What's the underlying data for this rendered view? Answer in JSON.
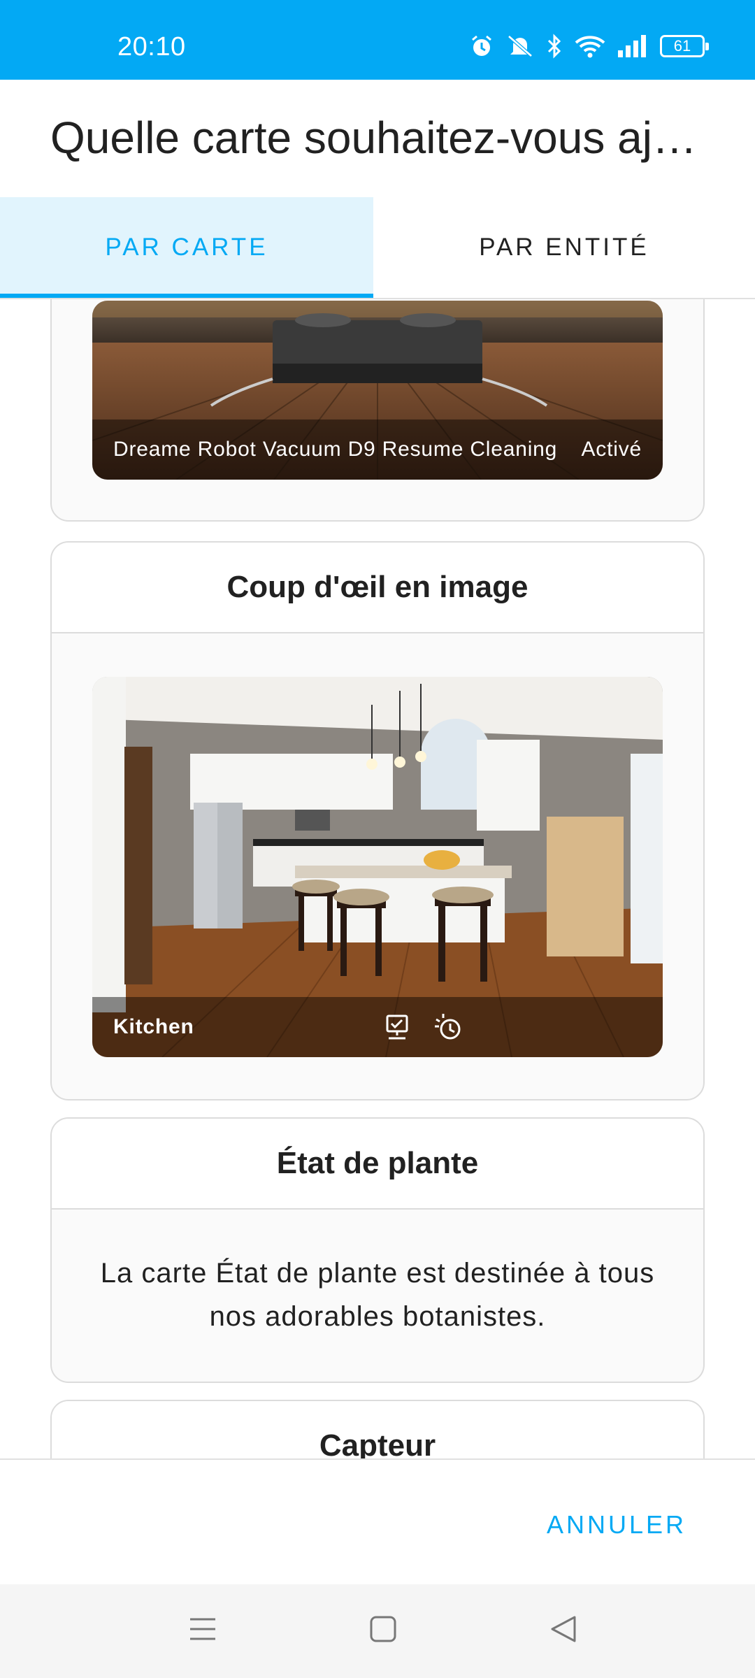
{
  "status_bar": {
    "time": "20:10",
    "battery": "61",
    "icons": [
      "alarm-icon",
      "mute-icon",
      "bluetooth-icon",
      "wifi-icon",
      "signal-icon",
      "battery-icon"
    ]
  },
  "dialog": {
    "title": "Quelle carte souhaitez-vous aj…"
  },
  "tabs": [
    {
      "label": "PAR CARTE",
      "active": true
    },
    {
      "label": "PAR ENTITÉ",
      "active": false
    }
  ],
  "cards": {
    "picture_entity": {
      "name": "Dreame Robot Vacuum D9 Resume Cleaning",
      "state": "Activé"
    },
    "picture_glance": {
      "title": "Coup d'œil en image",
      "area": "Kitchen",
      "icons": [
        "monitor-check-icon",
        "robot-timer-icon"
      ]
    },
    "plant_status": {
      "title": "État de plante",
      "description": "La carte État de plante est destinée à tous nos adorables botanistes."
    },
    "sensor": {
      "title": "Capteur"
    }
  },
  "footer": {
    "cancel_label": "ANNULER"
  },
  "colors": {
    "accent": "#03a9f4",
    "tab_active_bg": "#e1f4fd"
  }
}
